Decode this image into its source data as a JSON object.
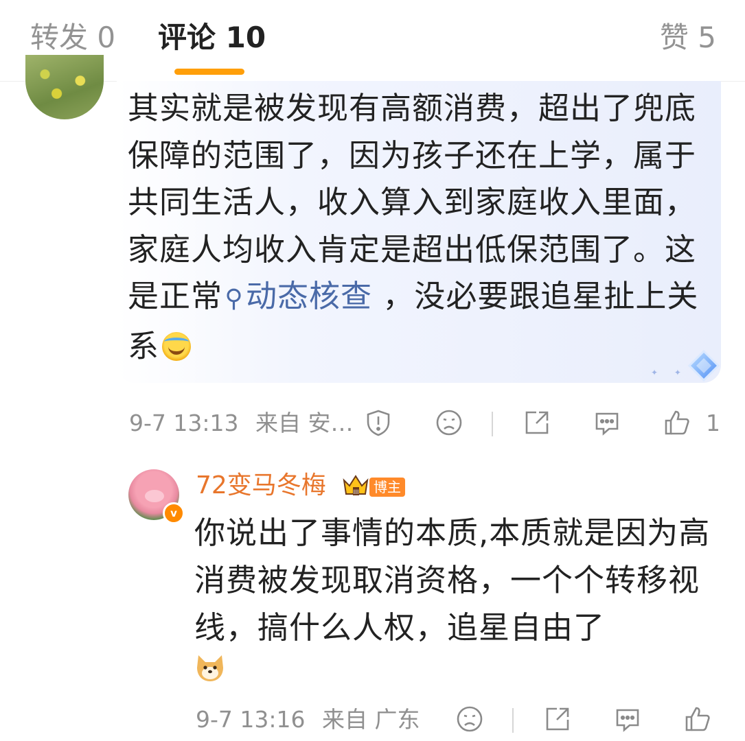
{
  "tabs": {
    "repost": "转发 0",
    "comments": "评论 10",
    "likes": "赞 5"
  },
  "comment1": {
    "text_before_topic": "其实就是被发现有高额消费，超出了兜底保障的范围了，因为孩子还在上学，属于共同生活人，收入算入到家庭收入里面，家庭人均收入肯定是超出低保范围了。这是正常",
    "topic_link": "动态核查",
    "text_after_topic": " ，没必要跟追星扯上关系",
    "time": "9-7 13:13",
    "source": "来自 安…",
    "like_count": "1"
  },
  "reply": {
    "username": "72变马冬梅",
    "author_badge": "博主",
    "verified_badge": "v",
    "text": "你说出了事情的本质,本质就是因为高消费被发现取消资格，一个个转移视线，搞什么人权，追星自由了",
    "time": "9-7 13:16",
    "source": "来自 广东"
  },
  "colors": {
    "accent": "#ff9f0a",
    "username": "#e8762c",
    "topic_link": "#4a6aa8",
    "muted_text": "#909090"
  },
  "icons": [
    "report-icon",
    "dislike-icon",
    "share-icon",
    "comment-icon",
    "like-icon",
    "search-topic-icon",
    "crown-icon",
    "laugh-cry-emoji",
    "dog-emoji"
  ]
}
